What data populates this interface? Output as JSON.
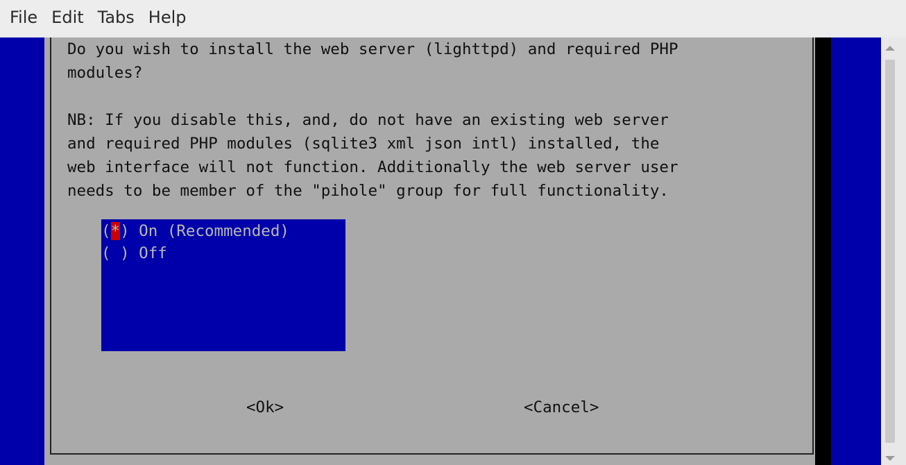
{
  "menu": {
    "items": [
      "File",
      "Edit",
      "Tabs",
      "Help"
    ]
  },
  "dialog": {
    "lines": [
      "Do you wish to install the web server (lighttpd) and required PHP",
      "modules?",
      "",
      "NB: If you disable this, and, do not have an existing web server",
      "and required PHP modules (sqlite3 xml json intl) installed, the",
      "web interface will not function. Additionally the web server user",
      "needs to be member of the \"pihole\" group for full functionality."
    ],
    "options": [
      {
        "prefix": "(",
        "mark": "*",
        "suffix": ") On (Recommended)",
        "selected": true
      },
      {
        "prefix": "(",
        "mark": " ",
        "suffix": ") Off",
        "selected": false
      }
    ],
    "ok_label": "<Ok>",
    "cancel_label": "<Cancel>"
  },
  "colors": {
    "terminal_bg": "#0000aa",
    "dialog_bg": "#aaaaaa",
    "selected_mark": "#cc0000"
  }
}
